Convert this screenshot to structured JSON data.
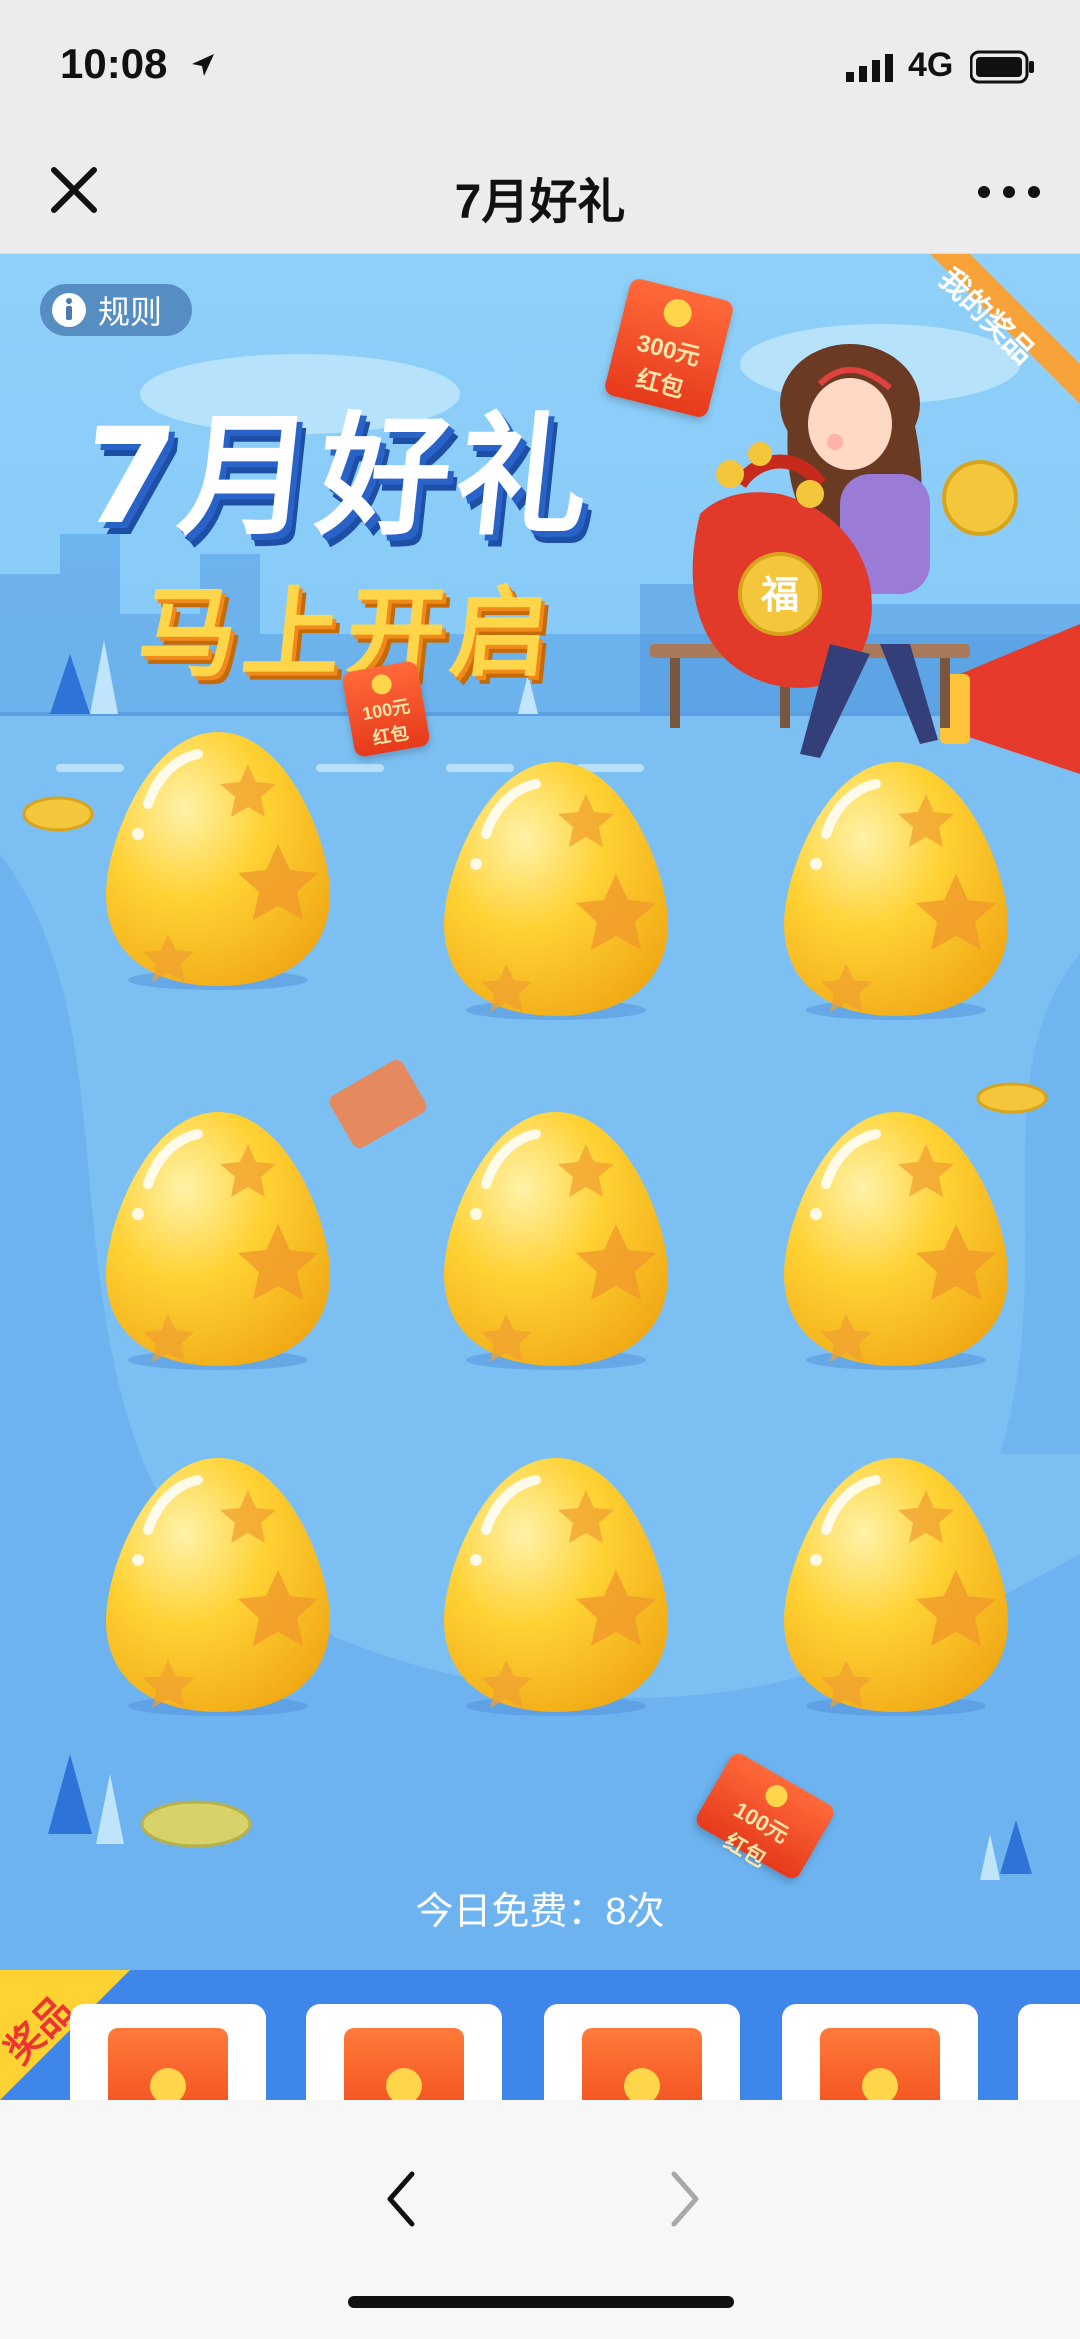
{
  "status_bar": {
    "time": "10:08",
    "network": "4G"
  },
  "nav": {
    "title": "7月好礼"
  },
  "banner": {
    "rules_label": "规则",
    "my_prizes_label": "我的奖品",
    "title": "7月好礼",
    "subtitle": "马上开启",
    "redpack_300_amount": "300元",
    "redpack_300_note": "红包",
    "redpack_100_amount": "100元",
    "redpack_100_note": "红包",
    "lucky_char": "福"
  },
  "eggs": [
    {
      "id": "egg-1"
    },
    {
      "id": "egg-2"
    },
    {
      "id": "egg-3"
    },
    {
      "id": "egg-4"
    },
    {
      "id": "egg-5"
    },
    {
      "id": "egg-6"
    },
    {
      "id": "egg-7"
    },
    {
      "id": "egg-8"
    },
    {
      "id": "egg-9"
    }
  ],
  "free_count_text": "今日免费：8次",
  "prize_strip": {
    "label": "奖品",
    "items": [
      "红包",
      "红包",
      "红包",
      "红包"
    ]
  },
  "colors": {
    "sky": "#7cc4f4",
    "accent": "#ff9a2e",
    "egg": "#ffd234",
    "strip": "#3e86ea"
  }
}
